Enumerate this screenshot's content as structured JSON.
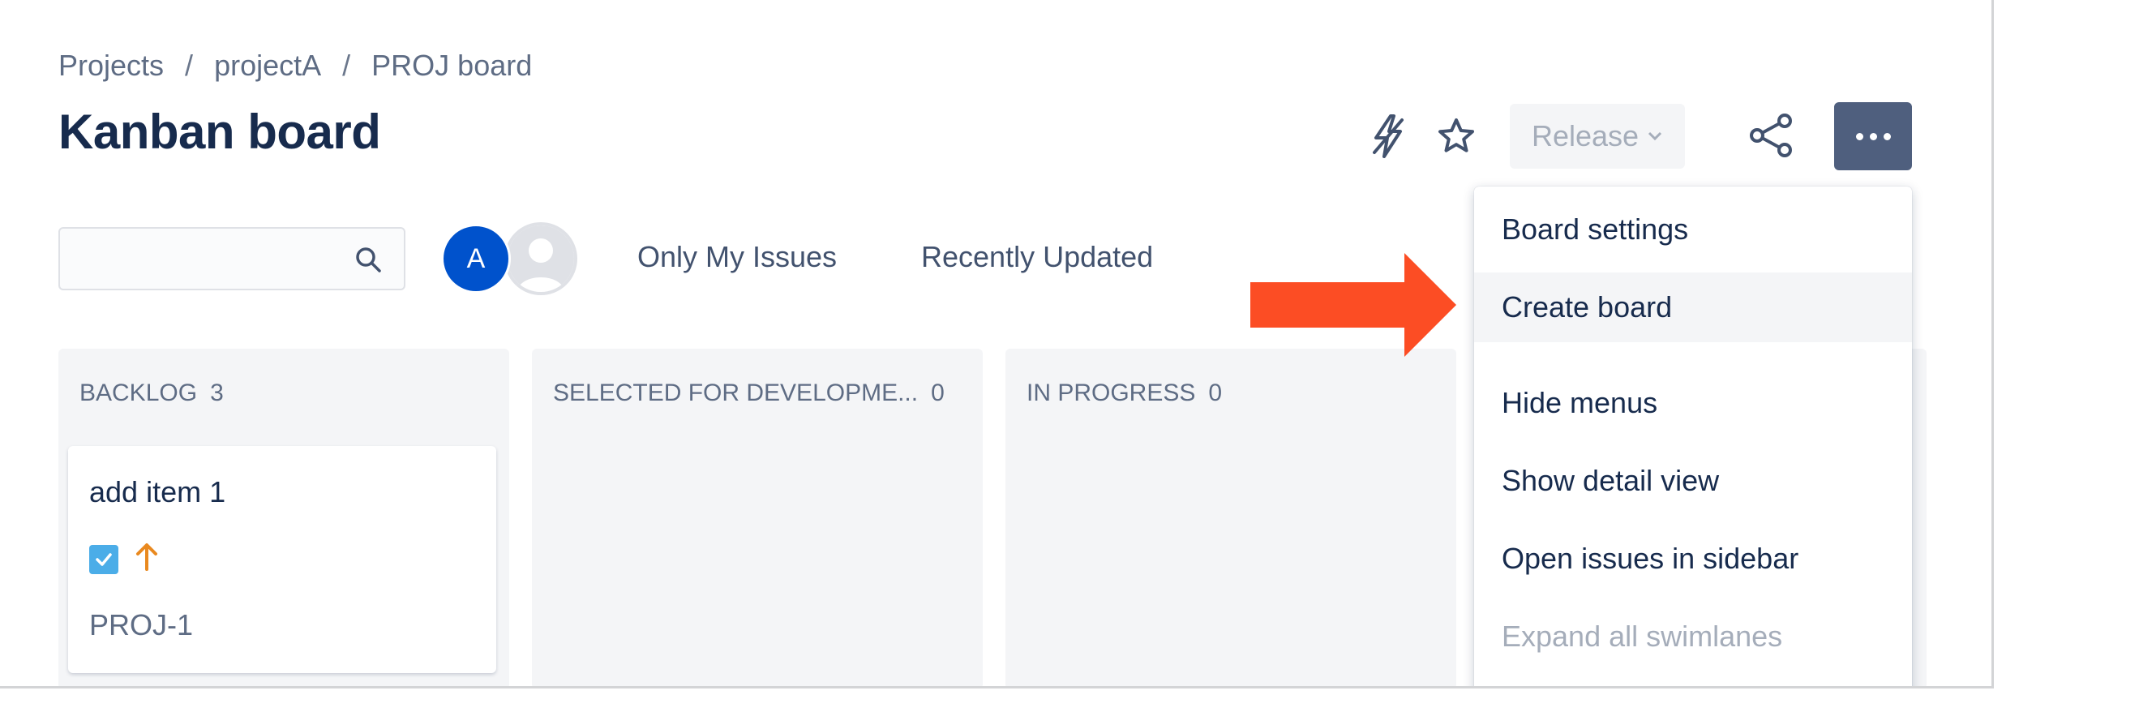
{
  "breadcrumb": [
    "Projects",
    "projectA",
    "PROJ board"
  ],
  "breadcrumb_sep": "/",
  "page_title": "Kanban board",
  "header": {
    "release_label": "Release",
    "icons": [
      "automation-bolt-icon",
      "star-icon",
      "share-icon",
      "more-icon"
    ]
  },
  "search": {
    "value": "",
    "placeholder": ""
  },
  "avatars": {
    "user_a_initial": "A"
  },
  "quick_filters": [
    "Only My Issues",
    "Recently Updated"
  ],
  "columns": [
    {
      "name": "BACKLOG",
      "count": "3"
    },
    {
      "name": "SELECTED FOR DEVELOPME...",
      "count": "0"
    },
    {
      "name": "IN PROGRESS",
      "count": "0"
    }
  ],
  "card": {
    "title": "add item 1",
    "key": "PROJ-1",
    "issue_type_icon": "task-checkbox-icon",
    "priority_icon": "priority-high-arrow-icon"
  },
  "menu": {
    "items": [
      {
        "label": "Board settings",
        "state": "normal"
      },
      {
        "label": "Create board",
        "state": "hover"
      },
      {
        "label": "Hide menus",
        "state": "normal"
      },
      {
        "label": "Show detail view",
        "state": "normal"
      },
      {
        "label": "Open issues in sidebar",
        "state": "normal"
      },
      {
        "label": "Expand all swimlanes",
        "state": "disabled"
      }
    ]
  },
  "colors": {
    "accent_blue": "#0052cc",
    "more_button_bg": "#4f5f7e",
    "annotation_arrow": "#fc4d24",
    "task_icon": "#4bade8",
    "priority_orange": "#e9891f"
  }
}
